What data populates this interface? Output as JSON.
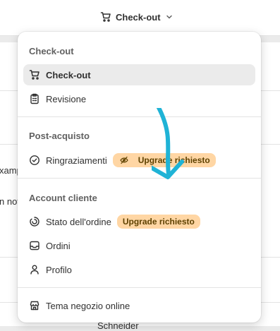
{
  "header": {
    "title": "Check-out",
    "cart_icon": "cart-icon",
    "dropdown_icon": "chevron-down-icon"
  },
  "background": {
    "text_1": "xamp",
    "text_2": "n not",
    "text_3": "Schneider"
  },
  "menu": {
    "sections": [
      {
        "title": "Check-out",
        "items": [
          {
            "label": "Check-out",
            "icon": "cart-icon",
            "active": true
          },
          {
            "label": "Revisione",
            "icon": "clipboard-icon"
          }
        ]
      },
      {
        "title": "Post-acquisto",
        "items": [
          {
            "label": "Ringraziamenti",
            "icon": "check-circle-icon",
            "badge": "Upgrade richiesto",
            "badge_icon": "eye-slash-icon"
          }
        ]
      },
      {
        "title": "Account cliente",
        "items": [
          {
            "label": "Stato dell'ordine",
            "icon": "order-status-icon",
            "badge": "Upgrade richiesto"
          },
          {
            "label": "Ordini",
            "icon": "inbox-icon"
          },
          {
            "label": "Profilo",
            "icon": "person-icon"
          }
        ]
      },
      {
        "title": "",
        "items": [
          {
            "label": "Tema negozio online",
            "icon": "store-icon"
          }
        ]
      }
    ]
  },
  "colors": {
    "badge_bg": "#ffd6a4",
    "badge_text": "#5e4200",
    "annotation_arrow": "#1fb3d6",
    "active_item_bg": "#ebebeb"
  }
}
